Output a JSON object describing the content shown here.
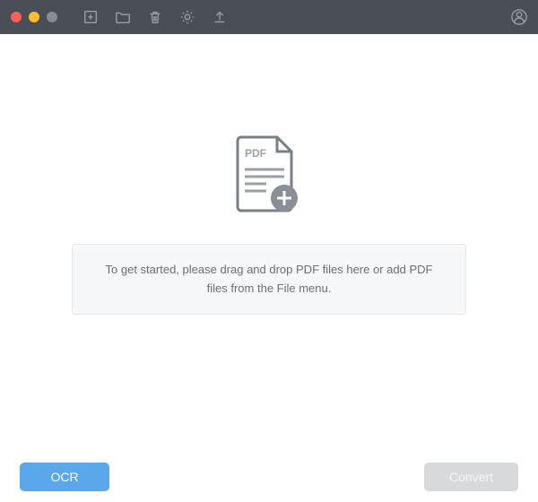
{
  "titlebar": {
    "icons": {
      "add": "add-file-icon",
      "folder": "folder-icon",
      "trash": "trash-icon",
      "settings": "gear-icon",
      "export": "upload-icon",
      "user": "user-icon"
    }
  },
  "main": {
    "pdf_label": "PDF",
    "hint_text": "To get started, please drag and drop PDF files here or add PDF files from the File menu."
  },
  "footer": {
    "ocr_label": "OCR",
    "convert_label": "Convert"
  },
  "colors": {
    "accent": "#5aa7ec",
    "titlebar": "#4a4e55"
  }
}
